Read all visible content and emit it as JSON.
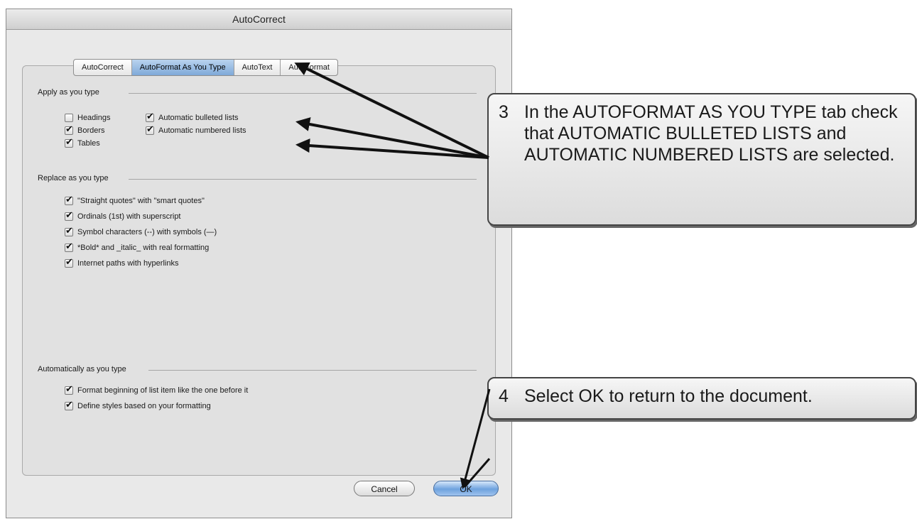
{
  "window": {
    "title": "AutoCorrect"
  },
  "tabs": [
    {
      "label": "AutoCorrect",
      "active": false
    },
    {
      "label": "AutoFormat As You Type",
      "active": true
    },
    {
      "label": "AutoText",
      "active": false
    },
    {
      "label": "AutoFormat",
      "active": false
    }
  ],
  "apply_section": {
    "label": "Apply as you type",
    "headings": {
      "label": "Headings",
      "checked": false
    },
    "borders": {
      "label": "Borders",
      "checked": true
    },
    "tables": {
      "label": "Tables",
      "checked": true
    },
    "bulleted": {
      "label": "Automatic bulleted lists",
      "checked": true
    },
    "numbered": {
      "label": "Automatic numbered lists",
      "checked": true
    }
  },
  "replace_section": {
    "label": "Replace as you type",
    "items": [
      {
        "label": "\"Straight quotes\" with \"smart quotes\"",
        "checked": true
      },
      {
        "label": "Ordinals (1st) with superscript",
        "checked": true
      },
      {
        "label": "Symbol characters (--) with symbols (—)",
        "checked": true
      },
      {
        "label": "*Bold* and _italic_ with real formatting",
        "checked": true
      },
      {
        "label": "Internet paths with hyperlinks",
        "checked": true
      }
    ]
  },
  "auto_section": {
    "label": "Automatically as you type",
    "items": [
      {
        "label": "Format beginning of list item like the one before it",
        "checked": true
      },
      {
        "label": "Define styles based on your formatting",
        "checked": true
      }
    ]
  },
  "buttons": {
    "cancel": "Cancel",
    "ok": "OK"
  },
  "callouts": {
    "step3": {
      "number": "3",
      "text": "In the AUTOFORMAT AS YOU TYPE tab check that AUTOMATIC BULLETED LISTS and AUTOMATIC NUMBERED LISTS are selected."
    },
    "step4": {
      "number": "4",
      "text": "Select OK to return to the document."
    }
  }
}
